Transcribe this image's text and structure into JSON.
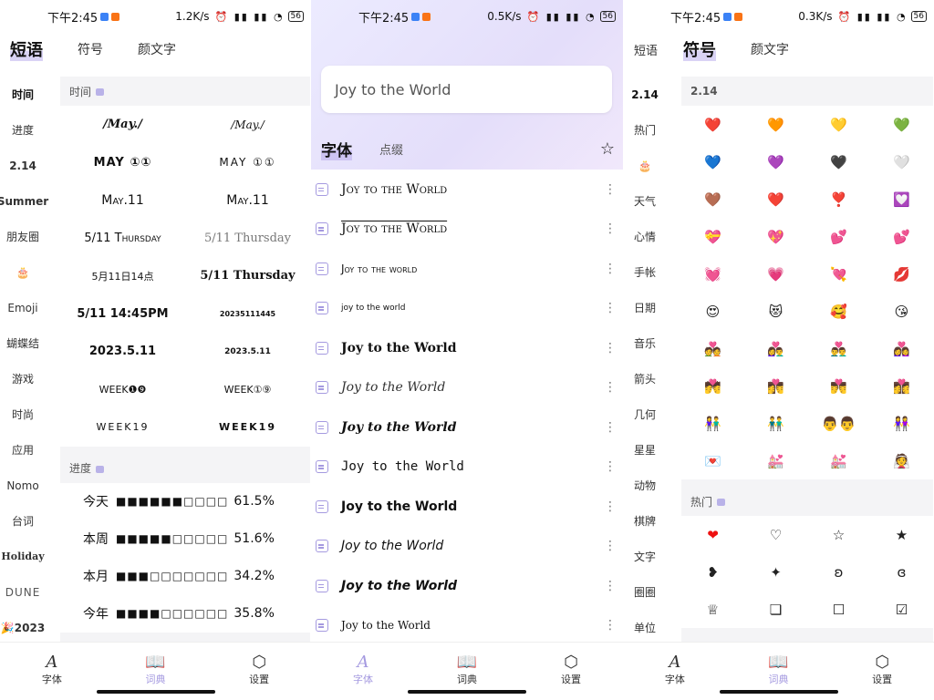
{
  "status_bars": [
    {
      "time": "下午2:45",
      "speed": "1.2K/s",
      "battery": "56"
    },
    {
      "time": "下午2:45",
      "speed": "0.5K/s",
      "battery": "56"
    },
    {
      "time": "下午2:45",
      "speed": "0.3K/s",
      "battery": "56"
    }
  ],
  "status_icons": "⏰ ▮▮ ▮▮ ◔",
  "panel1": {
    "top_tabs": [
      "短语",
      "符号",
      "颜文字"
    ],
    "left_nav": [
      "时间",
      "进度",
      "2.14",
      "Summer",
      "朋友圈",
      "🎂",
      "Emoji",
      "蝴蝶结",
      "游戏",
      "时尚",
      "应用",
      "Nomo",
      "台词",
      "Holiday",
      "DUNE",
      "🎉2023"
    ],
    "sections": [
      {
        "title": "时间",
        "items": [
          "/May./",
          "/May./",
          "MAY ①①",
          "MAY ①①",
          "May.11",
          "May.11",
          "5/11 Thursday",
          "5/11 Thursday",
          "5月11日14点",
          "5/11 Thursday",
          "5/11 14:45PM",
          "20235111445",
          "2023.5.11",
          "2023.5.11",
          "WEEK❶❾",
          "WEEK①⑨",
          "WEEK19",
          "WEEK19"
        ]
      },
      {
        "title": "进度",
        "rows": [
          {
            "label": "今天",
            "bar": "■■■■■■□□□□",
            "pct": "61.5%"
          },
          {
            "label": "本周",
            "bar": "■■■■■□□□□□",
            "pct": "51.6%"
          },
          {
            "label": "本月",
            "bar": "■■■□□□□□□□",
            "pct": "34.2%"
          },
          {
            "label": "今年",
            "bar": "■■■■□□□□□□",
            "pct": "35.8%"
          }
        ]
      }
    ]
  },
  "panel2": {
    "search_value": "Joy to the World",
    "sub_tabs": [
      "字体",
      "点缀"
    ],
    "star_icon": "☆",
    "fonts": [
      "Joy to the World",
      "Joy to the World",
      "Joy to the world",
      "joy to the world",
      "Joy to the World",
      "Joy to the World",
      "Joy to the World",
      "Joy to the World",
      "Joy to the World",
      "Joy to the World",
      "Joy to the World",
      "Joy to the World"
    ]
  },
  "panel3": {
    "top_tabs": [
      "短语",
      "符号",
      "颜文字"
    ],
    "left_nav": [
      "2.14",
      "热门",
      "🎂",
      "天气",
      "心情",
      "手帐",
      "日期",
      "音乐",
      "箭头",
      "几何",
      "星星",
      "动物",
      "棋牌",
      "文字",
      "圈圈",
      "单位"
    ],
    "sections": [
      {
        "title": "2.14",
        "items": [
          "❤️",
          "🧡",
          "💛",
          "💚",
          "💙",
          "💜",
          "🖤",
          "🤍",
          "🤎",
          "❤️",
          "❣️",
          "💟",
          "💝",
          "💖",
          "💕",
          "💕",
          "💓",
          "💗",
          "💘",
          "💋",
          "😍",
          "😻",
          "🥰",
          "😘",
          "💑",
          "👩‍❤️‍👨",
          "👨‍❤️‍👨",
          "👩‍❤️‍👩",
          "💏",
          "👩‍❤️‍💋‍👨",
          "👨‍❤️‍💋‍👨",
          "👩‍❤️‍💋‍👩",
          "👫",
          "👬",
          "👨‍👨",
          "👭",
          "💌",
          "💒",
          "💒",
          "👰"
        ]
      },
      {
        "title": "热门",
        "items": [
          "❤",
          "♡",
          "☆",
          "★",
          "❥",
          "✦",
          "ʚ",
          "ɞ",
          "♕",
          "❏",
          "☐",
          "☑"
        ]
      }
    ]
  },
  "bottom_nav": [
    "字体",
    "词典",
    "设置"
  ],
  "bottom_icons": [
    "A",
    "📖",
    "⬡"
  ],
  "colors": {
    "accent": "#a59ae0",
    "highlight": "#d9d3f5"
  }
}
